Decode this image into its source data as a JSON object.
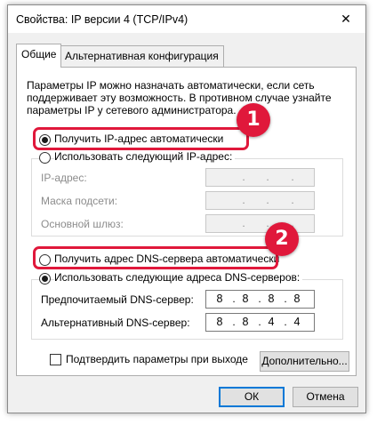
{
  "window": {
    "title": "Свойства: IP версии 4 (TCP/IPv4)",
    "close_glyph": "✕"
  },
  "tabs": [
    {
      "label": "Общие"
    },
    {
      "label": "Альтернативная конфигурация"
    }
  ],
  "description": {
    "line1": "Параметры IP можно назначать автоматически, если сеть",
    "line2": "поддерживает эту возможность. В противном случае узнайте",
    "line3": "параметры IP у сетевого администратора."
  },
  "ip": {
    "auto_label": "Получить IP-адрес автоматически",
    "manual_label": "Использовать следующий IP-адрес:",
    "address_label": "IP-адрес:",
    "mask_label": "Маска подсети:",
    "gateway_label": "Основной шлюз:"
  },
  "dns": {
    "auto_label": "Получить адрес DNS-сервера автоматически",
    "manual_label": "Использовать следующие адреса DNS-серверов:",
    "preferred_label": "Предпочитаемый DNS-сервер:",
    "alternate_label": "Альтернативный DNS-сервер:",
    "preferred_octets": [
      "8",
      "8",
      "8",
      "8"
    ],
    "alternate_octets": [
      "8",
      "8",
      "4",
      "4"
    ]
  },
  "validate_label": "Подтвердить параметры при выходе",
  "buttons": {
    "advanced": "Дополнительно...",
    "ok": "ОК",
    "cancel": "Отмена"
  },
  "annotations": {
    "badge1": "1",
    "badge2": "2",
    "color": "#e0183b"
  }
}
